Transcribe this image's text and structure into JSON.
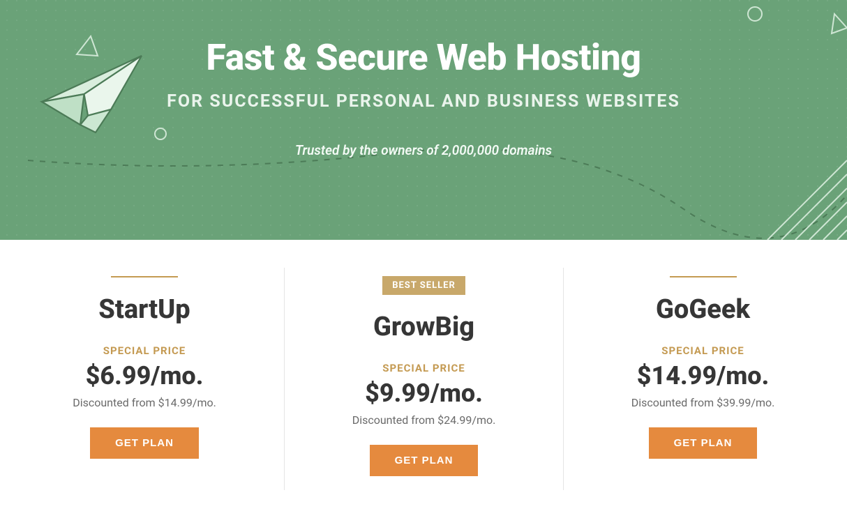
{
  "hero": {
    "title": "Fast & Secure Web Hosting",
    "subtitle": "FOR SUCCESSFUL PERSONAL AND BUSINESS WEBSITES",
    "trusted": "Trusted by the owners of 2,000,000 domains"
  },
  "plans_common": {
    "special_label": "SPECIAL PRICE",
    "cta_label": "GET PLAN"
  },
  "plans": [
    {
      "badge": "",
      "name": "StartUp",
      "price": "$6.99/mo.",
      "discounted": "Discounted from $14.99/mo."
    },
    {
      "badge": "BEST SELLER",
      "name": "GrowBig",
      "price": "$9.99/mo.",
      "discounted": "Discounted from $24.99/mo."
    },
    {
      "badge": "",
      "name": "GoGeek",
      "price": "$14.99/mo.",
      "discounted": "Discounted from $39.99/mo."
    }
  ],
  "colors": {
    "hero_bg": "#6ea97d",
    "accent_gold": "#c49a52",
    "cta_orange": "#e58a3e"
  }
}
